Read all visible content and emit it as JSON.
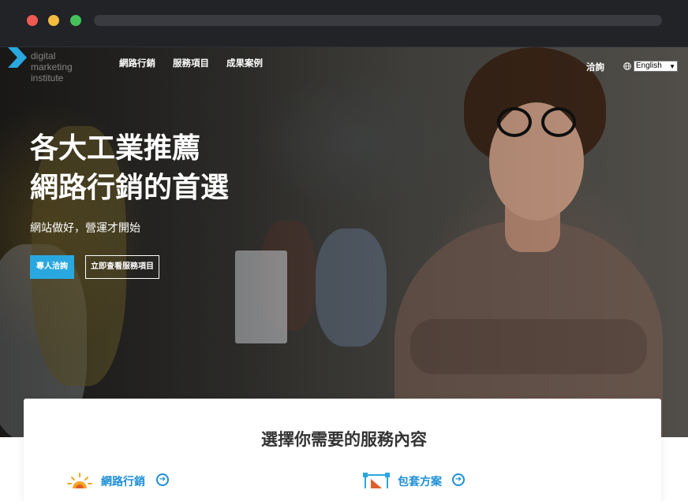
{
  "header": {
    "logo": {
      "line1": "digital",
      "line2": "marketing",
      "line3": "institute"
    },
    "nav": [
      "網路行銷",
      "服務項目",
      "成果案例"
    ],
    "contact": "洽詢",
    "language": {
      "selected": "English"
    }
  },
  "hero": {
    "title_line1": "各大工業推薦",
    "title_line2": "網路行銷的首選",
    "subtitle": "網站做好，營運才開始",
    "primary_button": "專人洽詢",
    "secondary_button": "立即查看服務項目"
  },
  "services": {
    "title": "選擇你需要的服務內容",
    "items": [
      {
        "label": "網路行銷",
        "icon": "sun-icon"
      },
      {
        "label": "包套方案",
        "icon": "package-icon"
      }
    ]
  },
  "colors": {
    "accent": "#29a8e0",
    "link": "#1d8fd6",
    "chrome": "#222327"
  }
}
